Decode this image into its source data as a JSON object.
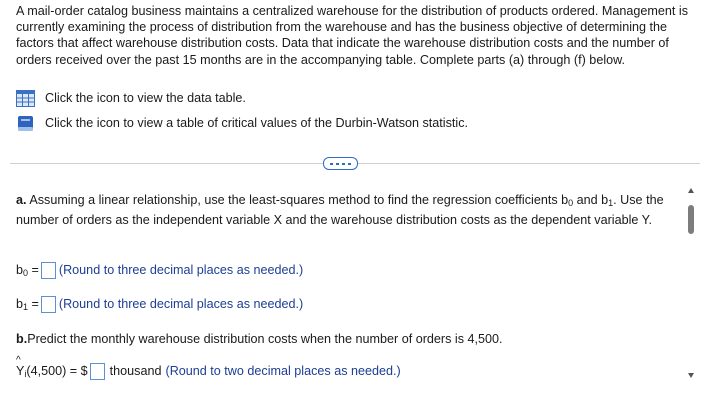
{
  "problem": {
    "intro": "A mail-order catalog business maintains a centralized warehouse for the distribution of products ordered. Management is currently examining the process of distribution from the warehouse and has the business objective of determining the factors that affect warehouse distribution costs. Data that indicate the warehouse distribution costs and the number of orders received over the past 15 months are in the accompanying table. Complete parts (a) through (f) below.",
    "data_table_link": "Click the icon to view the data table.",
    "dw_table_link": "Click the icon to view a table of critical values of the Durbin-Watson statistic."
  },
  "part_a": {
    "prefix": "a.",
    "text1": " Assuming a linear relationship, use the least-squares method to find the regression coefficients b",
    "sub0": "0",
    "text2": " and b",
    "sub1": "1",
    "text3": ". Use the number of orders as the independent variable X and the warehouse distribution costs as the dependent variable Y.",
    "b0_label": "b",
    "b0_sub": "0",
    "b0_eq": " =",
    "b0_value": "",
    "b0_hint": "(Round to three decimal places as needed.)",
    "b1_label": "b",
    "b1_sub": "1",
    "b1_eq": " =",
    "b1_value": "",
    "b1_hint": "(Round to three decimal places as needed.)"
  },
  "part_b": {
    "prefix": "b.",
    "text": " Predict the monthly warehouse distribution costs when the number of orders is 4,500.",
    "y_label": "Y",
    "y_sub": "i",
    "y_arg": "(4,500) = $",
    "y_value": "",
    "unit": "thousand",
    "hint": "(Round to two decimal places as needed.)"
  },
  "colors": {
    "accent": "#1c3e94",
    "input_border": "#5b8fd6"
  },
  "icons": {
    "data_table": "table-grid-icon",
    "dw_table": "book-icon",
    "expander": "ellipsis-icon"
  }
}
